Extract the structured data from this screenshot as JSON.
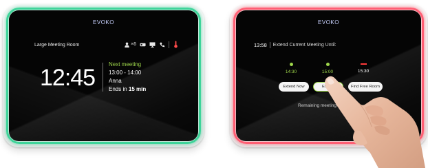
{
  "left_panel": {
    "brand": "EVOKO",
    "room_name": "Large Meeting Room",
    "capacity": "×6",
    "clock": "12:45",
    "next_meeting": {
      "title": "Next meeting",
      "time": "13:00 - 14:00",
      "organizer": "Anna",
      "ends_prefix": "Ends in ",
      "ends_value": "15 min"
    },
    "ring_color": "#3fd49a"
  },
  "right_panel": {
    "brand": "EVOKO",
    "clock": "13:58",
    "header_title": "Extend Current Meeting Until:",
    "slots": [
      {
        "time": "14:30",
        "status": "available"
      },
      {
        "time": "15:00",
        "status": "available"
      },
      {
        "time": "15:30",
        "status": "busy"
      }
    ],
    "buttons": [
      "Extend Now",
      "Extend",
      "Find Free Room"
    ],
    "remaining_text": "Remaining meeting ti",
    "ring_color": "#ff5f74"
  },
  "colors": {
    "available": "#9ed64b",
    "busy": "#ff3a3a"
  }
}
